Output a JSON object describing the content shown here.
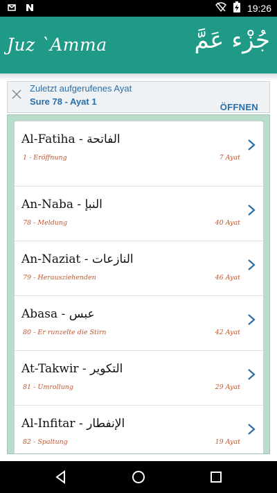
{
  "status_bar": {
    "time": "19:26",
    "left_icons": [
      "notification-icon",
      "n-app-icon"
    ],
    "right_icons": [
      "wifi-off-icon",
      "battery-charging-icon"
    ]
  },
  "app_bar": {
    "title_latin": "Juz `Amma",
    "title_arabic": "جُزْء عَمَّ",
    "color": "#1f9a86"
  },
  "banner": {
    "title": "Zuletzt aufgerufenes Ayat",
    "subtitle": "Sure 78 - Ayat 1",
    "open_label": "ÖFFNEN",
    "close_icon": "close-icon"
  },
  "surahs": [
    {
      "title": "Al-Fatiha - الفاتحة",
      "subtitle": "1 - Eröffnung",
      "ayat": "7 Ayat"
    },
    {
      "title": "An-Naba - النبإ",
      "subtitle": "78 - Meldung",
      "ayat": "40 Ayat"
    },
    {
      "title": "An-Naziat - النازعات",
      "subtitle": "79 - Herausziehenden",
      "ayat": "46 Ayat"
    },
    {
      "title": "Abasa - عبس",
      "subtitle": "80 - Er runzelte die Stirn",
      "ayat": "42 Ayat"
    },
    {
      "title": "At-Takwir - التكوير",
      "subtitle": "81 - Umrollung",
      "ayat": "29 Ayat"
    },
    {
      "title": "Al-Infitar - الإنفطار",
      "subtitle": "82 - Spaltung",
      "ayat": "19 Ayat"
    }
  ],
  "nav_bar": {
    "buttons": [
      "back-icon",
      "home-icon",
      "recents-icon"
    ]
  }
}
